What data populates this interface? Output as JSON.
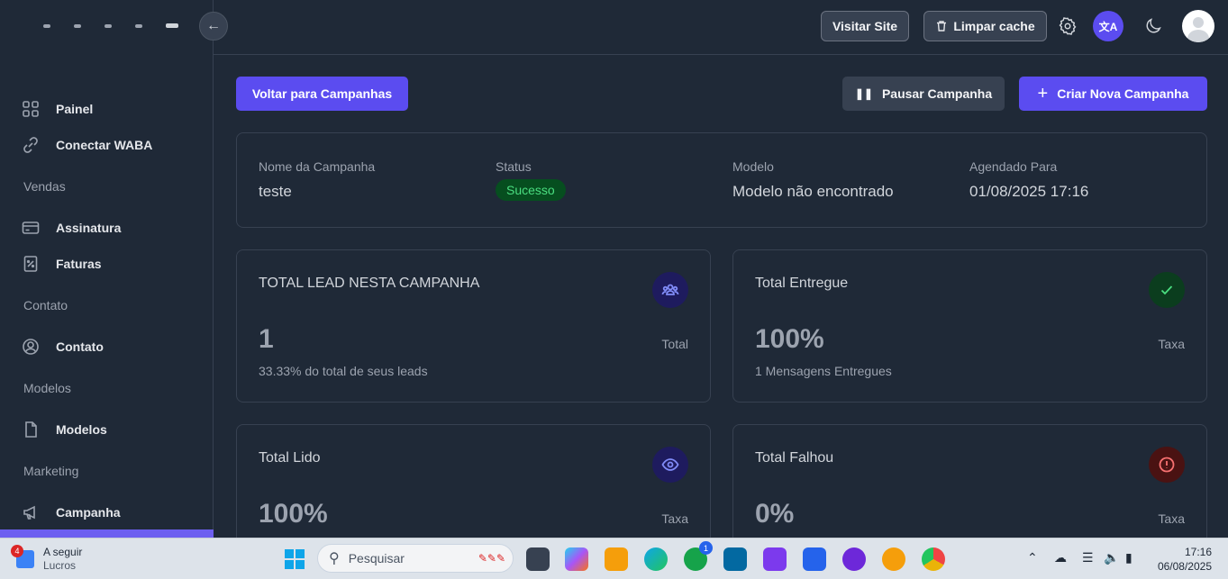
{
  "topbar": {
    "visit_site": "Visitar Site",
    "clear_cache": "Limpar cache",
    "lang_label": "文A"
  },
  "sidebar": {
    "items": [
      {
        "label": "Painel"
      },
      {
        "label": "Conectar WABA"
      },
      {
        "section": "Vendas"
      },
      {
        "label": "Assinatura"
      },
      {
        "label": "Faturas"
      },
      {
        "section": "Contato"
      },
      {
        "label": "Contato"
      },
      {
        "section": "Modelos"
      },
      {
        "label": "Modelos"
      },
      {
        "section": "Marketing"
      },
      {
        "label": "Campanha"
      }
    ]
  },
  "actions": {
    "back": "Voltar para Campanhas",
    "pause": "Pausar Campanha",
    "create": "Criar Nova Campanha"
  },
  "campaign": {
    "name_label": "Nome da Campanha",
    "name_value": "teste",
    "status_label": "Status",
    "status_value": "Sucesso",
    "model_label": "Modelo",
    "model_value": "Modelo não encontrado",
    "scheduled_label": "Agendado Para",
    "scheduled_value": "01/08/2025 17:16"
  },
  "stats": {
    "total_leads": {
      "title": "TOTAL LEAD NESTA CAMPANHA",
      "value": "1",
      "unit": "Total",
      "sub": "33.33% do total de seus leads",
      "icon": "users-icon",
      "color": "#1e1b5e"
    },
    "delivered": {
      "title": "Total Entregue",
      "value": "100%",
      "unit": "Taxa",
      "sub": "1 Mensagens Entregues",
      "icon": "check-icon",
      "color": "#0b3d1e"
    },
    "read": {
      "title": "Total Lido",
      "value": "100%",
      "unit": "Taxa",
      "icon": "eye-icon",
      "color": "#1e1b5e"
    },
    "failed": {
      "title": "Total Falhou",
      "value": "0%",
      "unit": "Taxa",
      "icon": "alert-icon",
      "color": "#4a1212"
    }
  },
  "taskbar": {
    "weather_title": "A seguir",
    "weather_sub": "Lucros",
    "weather_badge": "4",
    "search_placeholder": "Pesquisar",
    "whatsapp_badge": "1",
    "time": "17:16",
    "date": "06/08/2025"
  }
}
